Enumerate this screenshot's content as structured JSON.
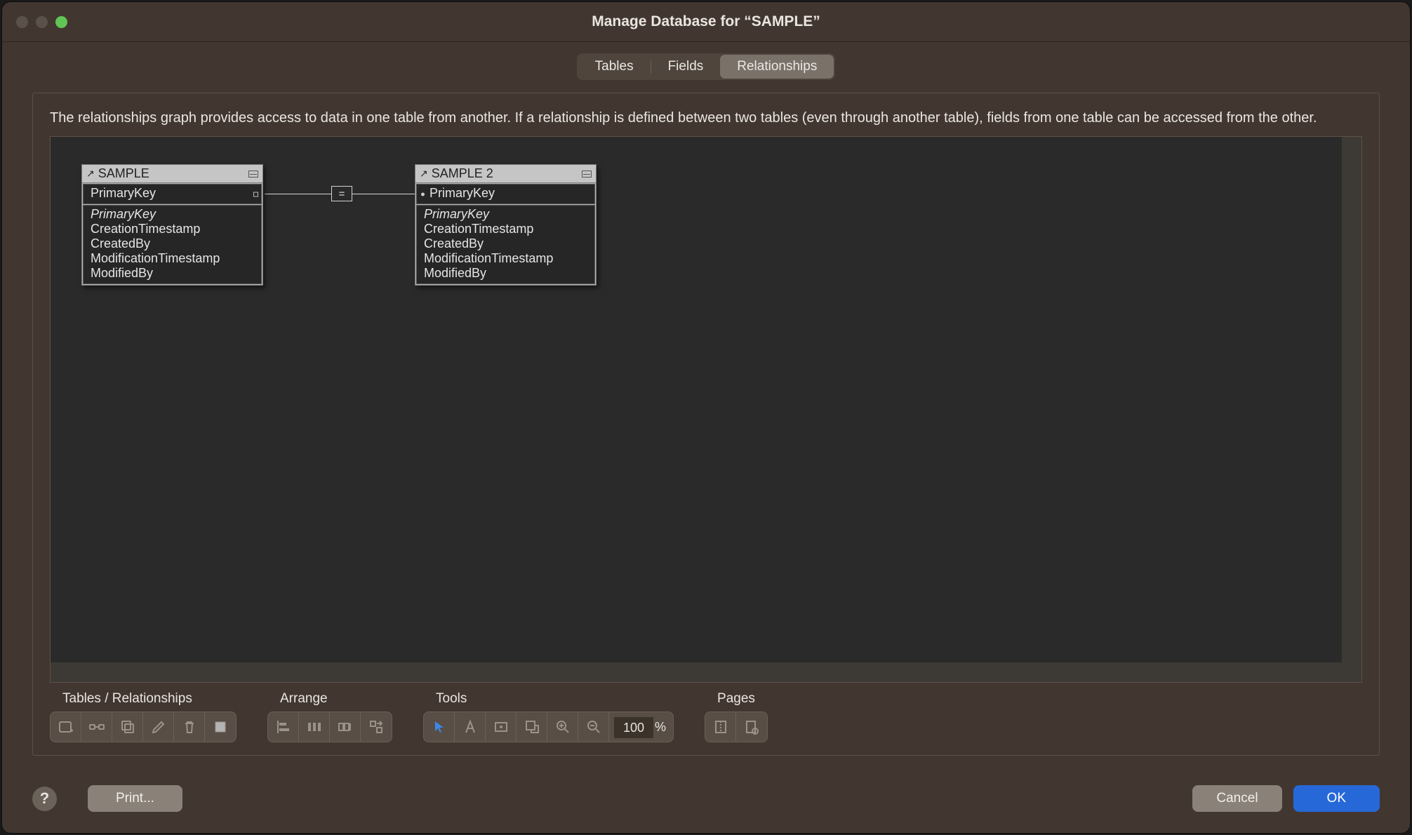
{
  "window": {
    "title": "Manage Database for “SAMPLE”"
  },
  "tabs": {
    "tables": "Tables",
    "fields": "Fields",
    "relationships": "Relationships",
    "active": "relationships"
  },
  "description": "The relationships graph provides access to data in one table from another. If a relationship is defined between two tables (even through another table), fields from one table can be accessed from the other.",
  "graph": {
    "tables": [
      {
        "name": "SAMPLE",
        "key": "PrimaryKey",
        "fields": [
          "PrimaryKey",
          "CreationTimestamp",
          "CreatedBy",
          "ModificationTimestamp",
          "ModifiedBy"
        ]
      },
      {
        "name": "SAMPLE 2",
        "key": "PrimaryKey",
        "fields": [
          "PrimaryKey",
          "CreationTimestamp",
          "CreatedBy",
          "ModificationTimestamp",
          "ModifiedBy"
        ]
      }
    ],
    "operator": "="
  },
  "toolbar": {
    "groups": {
      "tables_rel": "Tables / Relationships",
      "arrange": "Arrange",
      "tools": "Tools",
      "pages": "Pages"
    },
    "zoom": {
      "value": "100",
      "unit": "%"
    }
  },
  "footer": {
    "print": "Print...",
    "cancel": "Cancel",
    "ok": "OK",
    "help": "?"
  }
}
